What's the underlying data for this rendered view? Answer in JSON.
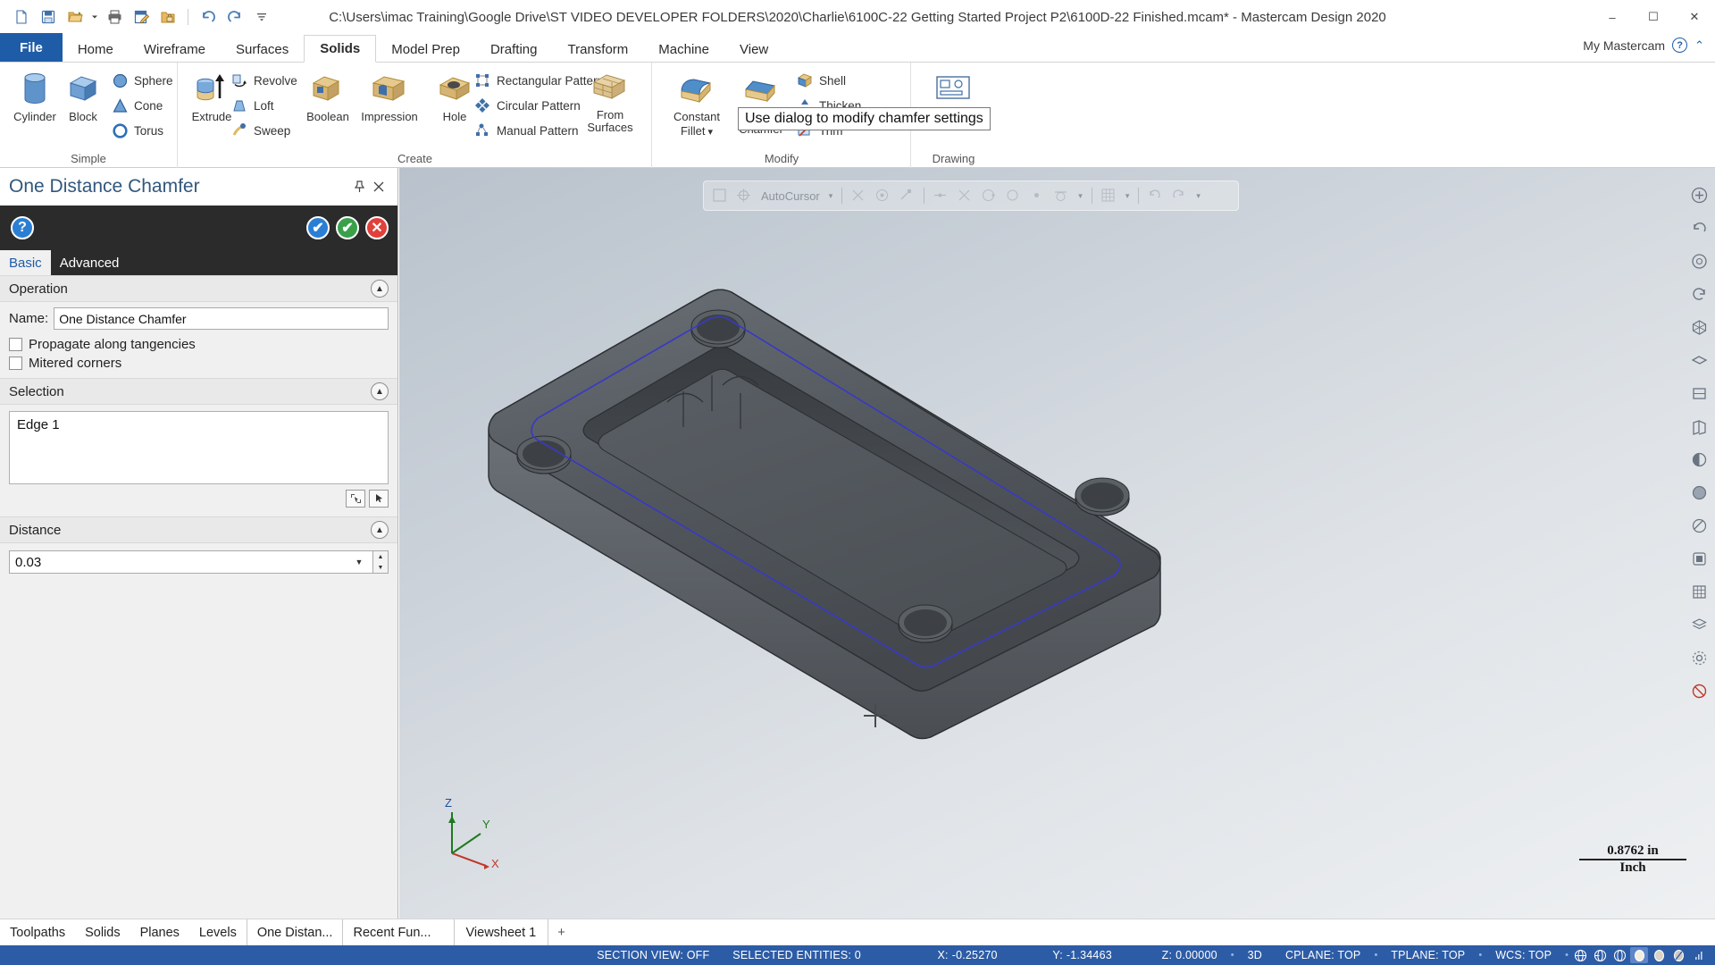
{
  "window": {
    "title": "C:\\Users\\imac Training\\Google Drive\\ST VIDEO DEVELOPER FOLDERS\\2020\\Charlie\\6100C-22 Getting Started Project P2\\6100D-22 Finished.mcam* - Mastercam Design 2020",
    "minimize": "–",
    "maximize": "☐",
    "close": "✕"
  },
  "quick_access": [
    {
      "name": "new-file-icon",
      "title": "New"
    },
    {
      "name": "save-icon",
      "title": "Save"
    },
    {
      "name": "open-folder-icon",
      "title": "Open"
    },
    {
      "name": "open-dropdown-icon",
      "title": "Open options"
    },
    {
      "name": "print-icon",
      "title": "Print"
    },
    {
      "name": "edit-file-icon",
      "title": "Edit"
    },
    {
      "name": "folder-lock-icon",
      "title": "Folder"
    },
    {
      "name": "undo-icon",
      "title": "Undo"
    },
    {
      "name": "redo-icon",
      "title": "Redo"
    },
    {
      "name": "customize-qat-icon",
      "title": "Customize Quick Access Toolbar"
    }
  ],
  "ribbon_tabs": [
    {
      "label": "File",
      "state": "file"
    },
    {
      "label": "Home",
      "state": "normal"
    },
    {
      "label": "Wireframe",
      "state": "normal"
    },
    {
      "label": "Surfaces",
      "state": "normal"
    },
    {
      "label": "Solids",
      "state": "active"
    },
    {
      "label": "Model Prep",
      "state": "normal"
    },
    {
      "label": "Drafting",
      "state": "normal"
    },
    {
      "label": "Transform",
      "state": "normal"
    },
    {
      "label": "Machine",
      "state": "normal"
    },
    {
      "label": "View",
      "state": "normal"
    }
  ],
  "account": {
    "label": "My Mastercam",
    "help": "?",
    "collapse": "⌃"
  },
  "ribbon_groups": [
    {
      "name": "Simple",
      "label": "Simple",
      "big_buttons": [
        {
          "label": "Cylinder",
          "icon": "cylinder-icon"
        },
        {
          "label": "Block",
          "icon": "block-icon"
        }
      ],
      "small_buttons": [
        {
          "label": "Sphere",
          "icon": "sphere-icon"
        },
        {
          "label": "Cone",
          "icon": "cone-icon"
        },
        {
          "label": "Torus",
          "icon": "torus-icon"
        }
      ]
    },
    {
      "name": "Create",
      "label": "Create",
      "big_buttons": [
        {
          "label": "Extrude",
          "icon": "extrude-icon"
        },
        {
          "label": "Boolean",
          "icon": "boolean-icon"
        },
        {
          "label": "Impression",
          "icon": "impression-icon"
        },
        {
          "label": "Hole",
          "icon": "hole-icon"
        },
        {
          "label": "From Surfaces",
          "icon": "from-surfaces-icon"
        }
      ],
      "small_buttons": [
        {
          "label": "Revolve",
          "icon": "revolve-icon"
        },
        {
          "label": "Loft",
          "icon": "loft-icon"
        },
        {
          "label": "Sweep",
          "icon": "sweep-icon"
        },
        {
          "label": "Rectangular Pattern",
          "icon": "rectangular-pattern-icon"
        },
        {
          "label": "Circular Pattern",
          "icon": "circular-pattern-icon"
        },
        {
          "label": "Manual Pattern",
          "icon": "manual-pattern-icon"
        }
      ]
    },
    {
      "name": "Modify",
      "label": "Modify",
      "big_buttons": [
        {
          "label": "Constant Fillet",
          "icon": "constant-fillet-icon",
          "dropdown": true
        },
        {
          "label": "One Distance Chamfer",
          "icon": "chamfer-icon",
          "dropdown": true
        }
      ],
      "small_buttons": [
        {
          "label": "Shell",
          "icon": "shell-icon"
        },
        {
          "label": "Thicken",
          "icon": "thicken-icon"
        },
        {
          "label": "Trim",
          "icon": "trim-icon"
        }
      ]
    },
    {
      "name": "Drawing",
      "label": "Drawing",
      "big_buttons": [
        {
          "label": "Plane",
          "icon": "drawing-plane-icon"
        }
      ],
      "small_buttons": []
    }
  ],
  "ribbon_extra": {
    "constant_fillet": "Constant",
    "constant_fillet2": "Fillet",
    "one_chamfer": "On",
    "one_chamfer2": "Chamfer",
    "from_surfaces1": "From",
    "from_surfaces2": "Surfaces",
    "plane": "Plane",
    "shell": "Shell",
    "thicken": "Thicken",
    "trim": "Trim"
  },
  "tooltip": {
    "text": "Use dialog to modify chamfer settings"
  },
  "panel": {
    "title": "One Distance Chamfer",
    "pin_icon": "pin-icon",
    "close_icon": "close-icon",
    "toolbar_icons": [
      {
        "name": "help-icon",
        "glyph": "?",
        "color": "#2a7fd4"
      },
      {
        "name": "apply-and-create-new-icon",
        "glyph": "✔",
        "color": "#2a7fd4"
      },
      {
        "name": "ok-icon",
        "glyph": "✔",
        "color": "#3aa14a"
      },
      {
        "name": "cancel-icon",
        "glyph": "✕",
        "color": "#e0413a"
      }
    ],
    "tabs": [
      {
        "label": "Basic",
        "active": true
      },
      {
        "label": "Advanced",
        "active": false
      }
    ],
    "sections": {
      "operation": {
        "header": "Operation",
        "name_label": "Name:",
        "name_value": "One Distance Chamfer",
        "checkboxes": [
          {
            "label": "Propagate along tangencies",
            "checked": false
          },
          {
            "label": "Mitered corners",
            "checked": false
          }
        ]
      },
      "selection": {
        "header": "Selection",
        "items": [
          "Edge 1"
        ],
        "buttons": [
          {
            "name": "reselect-button",
            "icon": "reselect-icon"
          },
          {
            "name": "end-selection-button",
            "icon": "cursor-icon"
          }
        ]
      },
      "distance": {
        "header": "Distance",
        "value": "0.03",
        "dropdown_icon": "chevron-down-icon",
        "spinner_up": "▲",
        "spinner_down": "▼"
      }
    }
  },
  "viewport": {
    "autocursor_label": "AutoCursor",
    "scale_value": "0.8762 in",
    "scale_unit": "Inch",
    "axis_x": "X",
    "axis_y": "Y",
    "axis_z": "Z"
  },
  "right_toolbar": [
    {
      "name": "fit-icon",
      "glyph": "+"
    },
    {
      "name": "unzoom-icon",
      "glyph": "↺"
    },
    {
      "name": "zoom-window-icon",
      "glyph": "○"
    },
    {
      "name": "dynamic-rotate-icon",
      "glyph": "↻"
    },
    {
      "name": "isometric-view-icon",
      "glyph": "▦"
    },
    {
      "name": "top-view-icon",
      "glyph": "▭"
    },
    {
      "name": "front-view-icon",
      "glyph": "□"
    },
    {
      "name": "right-view-icon",
      "glyph": "◱"
    },
    {
      "name": "wireframe-shading-icon",
      "glyph": "◔"
    },
    {
      "name": "shaded-icon",
      "glyph": "●"
    },
    {
      "name": "translucent-icon",
      "glyph": "◑"
    },
    {
      "name": "hidden-lines-icon",
      "glyph": "▣"
    },
    {
      "name": "mesh-icon",
      "glyph": "▤"
    },
    {
      "name": "layers-icon",
      "glyph": "☰"
    },
    {
      "name": "settings-icon",
      "glyph": "⚙"
    },
    {
      "name": "blank-icon",
      "glyph": "⊘"
    }
  ],
  "bottom_tabs": [
    {
      "label": "Toolpaths",
      "boxed": false
    },
    {
      "label": "Solids",
      "boxed": false
    },
    {
      "label": "Planes",
      "boxed": false
    },
    {
      "label": "Levels",
      "boxed": false
    },
    {
      "label": "One Distan...",
      "boxed": true
    },
    {
      "label": "Recent Fun...",
      "boxed": false
    }
  ],
  "viewsheet": {
    "label": "Viewsheet 1",
    "add": "+"
  },
  "statusbar": {
    "section_view": "SECTION VIEW: OFF",
    "selected_entities": "SELECTED ENTITIES: 0",
    "x_label": "X:",
    "x_value": "-0.25270",
    "y_label": "Y:",
    "y_value": "-1.34463",
    "z_label": "Z:",
    "z_value": "0.00000",
    "dim_mode": "3D",
    "cplane": "CPLANE: TOP",
    "tplane": "TPLANE: TOP",
    "wcs": "WCS: TOP",
    "icons": [
      {
        "name": "wireframe-view-icon",
        "selected": false
      },
      {
        "name": "hidden-lines-view-icon",
        "selected": false
      },
      {
        "name": "shading-wire-icon",
        "selected": false
      },
      {
        "name": "shaded-view-icon",
        "selected": true
      },
      {
        "name": "material-shaded-icon",
        "selected": false
      },
      {
        "name": "translucency-icon",
        "selected": false
      },
      {
        "name": "resize-grip-icon",
        "selected": false
      }
    ]
  },
  "colors": {
    "accent": "#1f5ca8",
    "statusbar": "#2d5ca6",
    "panel_dark": "#2b2b2b",
    "part_body": "#4a4e52",
    "edge_highlight": "#3a3ac0"
  }
}
